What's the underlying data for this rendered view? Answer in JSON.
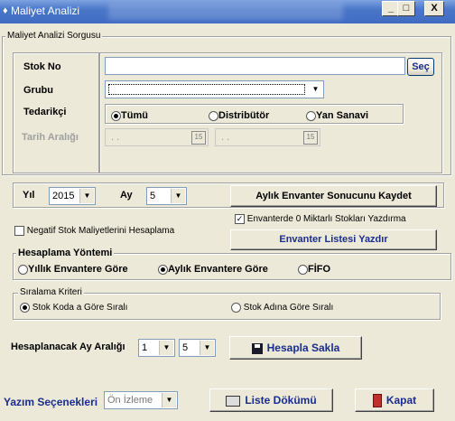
{
  "window": {
    "title": "Maliyet Analizi",
    "minimize": "_",
    "maximize": "□",
    "close": "X"
  },
  "query_group": {
    "title": "Maliyet Analizi Sorgusu",
    "stok_no_label": "Stok No",
    "stok_no_value": "",
    "sec_label": "Seç",
    "grubu_label": "Grubu",
    "grubu_value": "",
    "tedarikci_label": "Tedarikçi",
    "tedarikci_options": [
      "Tümü",
      "Distribütör",
      "Yan Sanavi"
    ],
    "tedarikci_selected": "Tümü",
    "tarih_label": "Tarih Aralığı",
    "date_start": ". .",
    "date_end": ". .",
    "cal_icon_text": "15"
  },
  "period": {
    "yil_label": "Yıl",
    "yil_value": "2015",
    "ay_label": "Ay",
    "ay_value": "5",
    "save_inventory_label": "Aylık Envanter Sonucunu Kaydet",
    "negatif_label": "Negatif Stok Maliyetlerini Hesaplama",
    "negatif_checked": false,
    "zero_stock_label": "Envanterde 0 Miktarlı Stokları Yazdırma",
    "zero_stock_checked": true,
    "print_inventory_label": "Envanter Listesi Yazdır"
  },
  "method_group": {
    "title": "Hesaplama Yöntemi",
    "options": [
      "Yıllık Envantere Göre",
      "Aylık Envantere Göre",
      "FİFO"
    ],
    "selected": "Aylık Envantere Göre"
  },
  "sort_group": {
    "title": "Sıralama Kriteri",
    "options": [
      "Stok Koda a Göre Sıralı",
      "Stok Adına Göre Sıralı"
    ],
    "selected": "Stok Koda a Göre Sıralı"
  },
  "calc": {
    "range_label": "Hesaplanacak Ay Aralığı",
    "from_value": "1",
    "to_value": "5",
    "save_button": "Hesapla Sakla"
  },
  "footer": {
    "yazim_label": "Yazım Seçenekleri",
    "yazim_value": "Ön İzleme",
    "list_button": "Liste Dökümü",
    "close_button": "Kapat"
  },
  "colors": {
    "label_blue": "#1a2d8c",
    "title_blue": "#3f6bc2",
    "disabled_gray": "#a0a0a0"
  }
}
